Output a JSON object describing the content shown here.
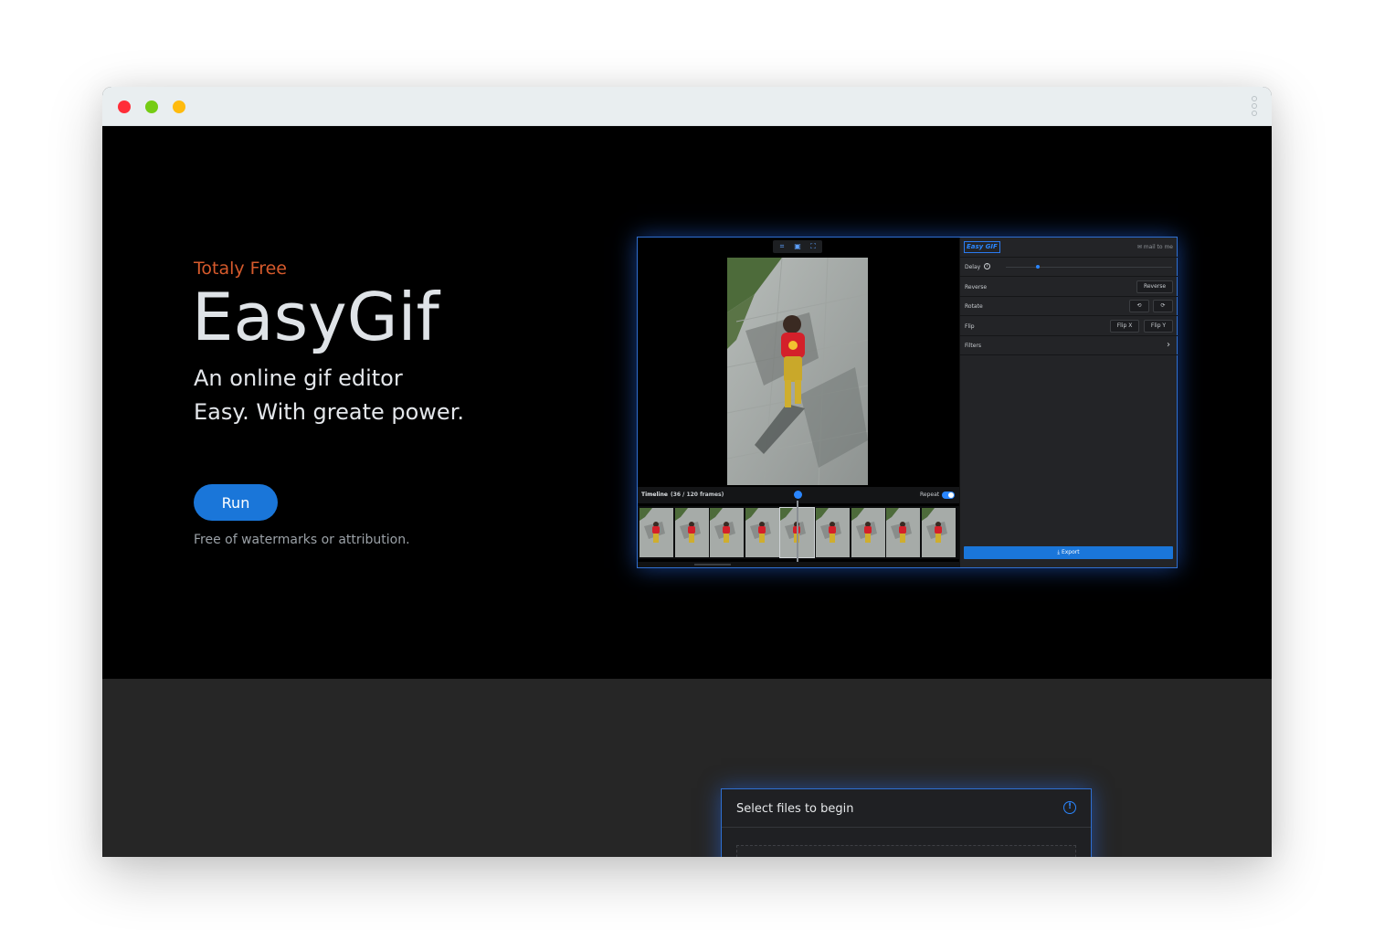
{
  "hero": {
    "eyebrow": "Totaly Free",
    "title": "EasyGif",
    "subtitle_line1": "An online gif editor",
    "subtitle_line2": "Easy. With greate power.",
    "run_label": "Run",
    "note": "Free of watermarks or attribution."
  },
  "preview": {
    "toolbar_icons": [
      "crop-icon",
      "image-icon",
      "resize-icon"
    ],
    "timeline": {
      "label": "Timeline",
      "frames": "(36 / 120 frames)",
      "repeat_label": "Repeat",
      "repeat_on": true,
      "selected_frame": 5,
      "thumbnail_count": 9
    },
    "sidebar": {
      "logo": "Easy GIF",
      "mail_label": "mail to me",
      "delay_label": "Delay",
      "delay_level": 0.18,
      "reverse_label": "Reverse",
      "reverse_button": "Reverse",
      "rotate_label": "Rotate",
      "flip_label": "Flip",
      "flip_x": "Flip X",
      "flip_y": "Flip Y",
      "filters_label": "Filters",
      "export_label": "Export"
    }
  },
  "upload_card": {
    "title": "Select files to begin"
  },
  "colors": {
    "accent": "#1a76d9",
    "eyebrow": "#d65a2c",
    "glow": "#2f6fd0"
  }
}
